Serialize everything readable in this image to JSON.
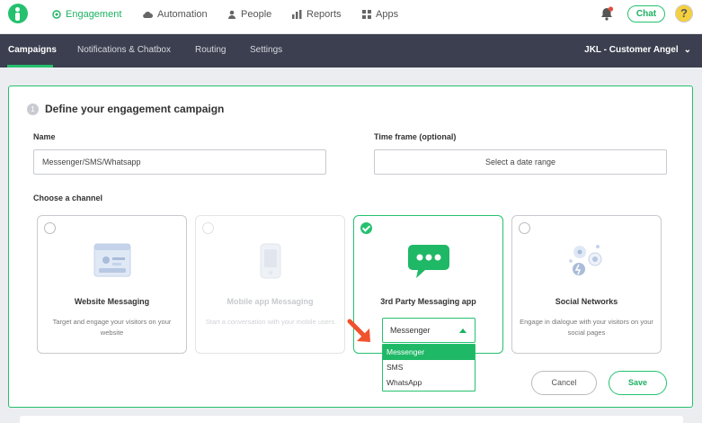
{
  "topnav": {
    "items": [
      {
        "label": "Engagement",
        "icon": "target-icon"
      },
      {
        "label": "Automation",
        "icon": "cloud-icon"
      },
      {
        "label": "People",
        "icon": "person-icon"
      },
      {
        "label": "Reports",
        "icon": "bar-chart-icon"
      },
      {
        "label": "Apps",
        "icon": "grid-icon"
      }
    ],
    "chat_label": "Chat",
    "avatar_glyph": "?"
  },
  "subnav": {
    "tabs": [
      "Campaigns",
      "Notifications & Chatbox",
      "Routing",
      "Settings"
    ],
    "account": "JKL - Customer Angel",
    "account_caret": "⌄"
  },
  "panel": {
    "step": "1",
    "title": "Define your engagement campaign",
    "name_label": "Name",
    "name_value": "Messenger/SMS/Whatsapp",
    "timeframe_label": "Time frame (optional)",
    "timeframe_value": "Select a date range",
    "channel_label": "Choose a channel",
    "channels": [
      {
        "title": "Website Messaging",
        "desc": "Target and engage your visitors on your website"
      },
      {
        "title": "Mobile app Messaging",
        "desc": "Start a conversation with your mobile users"
      },
      {
        "title": "3rd Party Messaging app",
        "desc": ""
      },
      {
        "title": "Social Networks",
        "desc": "Engage in dialogue with your visitors on your social pages"
      }
    ],
    "select_value": "Messenger",
    "options": [
      "Messenger",
      "SMS",
      "WhatsApp"
    ],
    "cancel_label": "Cancel",
    "save_label": "Save"
  },
  "colors": {
    "accent": "#25c16f",
    "subnav_bg": "#3b3f4f",
    "arrow": "#f0522d"
  }
}
